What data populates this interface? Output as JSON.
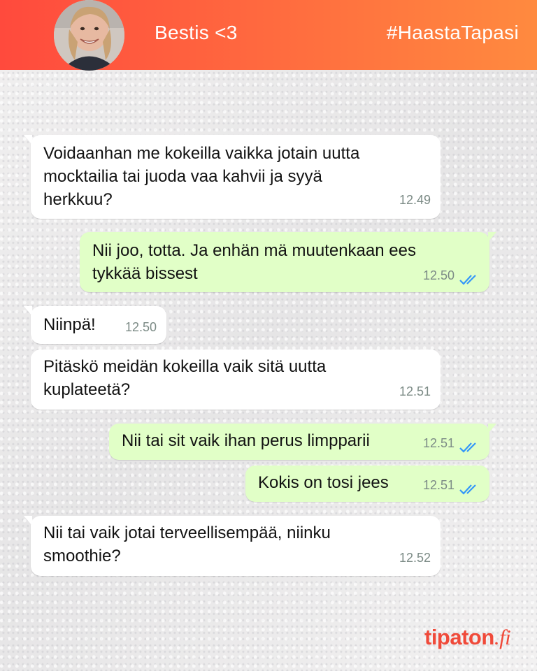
{
  "header": {
    "contact_name": "Bestis <3",
    "hashtag": "#HaastaTapasi",
    "avatar_icon": "profile-photo"
  },
  "messages": [
    {
      "direction": "incoming",
      "text": "Voidaanhan me kokeilla vaikka jotain uutta\nmocktailia tai juoda vaa kahvii ja syyä\nherkkuu?",
      "time": "12.49"
    },
    {
      "direction": "outgoing",
      "text": "Nii joo, totta. Ja enhän mä muutenkaan ees\ntykkää bissest",
      "time": "12.50",
      "status": "read"
    },
    {
      "direction": "incoming",
      "text": "Niinpä!",
      "time": "12.50"
    },
    {
      "direction": "incoming",
      "text": "Pitäskö meidän kokeilla vaik sitä uutta\nkuplateetä?",
      "time": "12.51"
    },
    {
      "direction": "outgoing",
      "text": "Nii tai sit vaik ihan perus limpparii",
      "time": "12.51",
      "status": "read"
    },
    {
      "direction": "outgoing",
      "text": "Kokis on tosi jees",
      "time": "12.51",
      "status": "read"
    },
    {
      "direction": "incoming",
      "text": "Nii tai vaik jotai terveellisempää, niinku\nsmoothie?",
      "time": "12.52"
    }
  ],
  "branding": {
    "logo_main": "tipaton",
    "logo_suffix": ".fi"
  },
  "colors": {
    "header_start": "#ff4a3d",
    "header_end": "#ff8a3f",
    "outgoing_bubble": "#e1ffc7",
    "incoming_bubble": "#ffffff",
    "read_ticks": "#3497f9",
    "logo": "#f04a3a"
  }
}
